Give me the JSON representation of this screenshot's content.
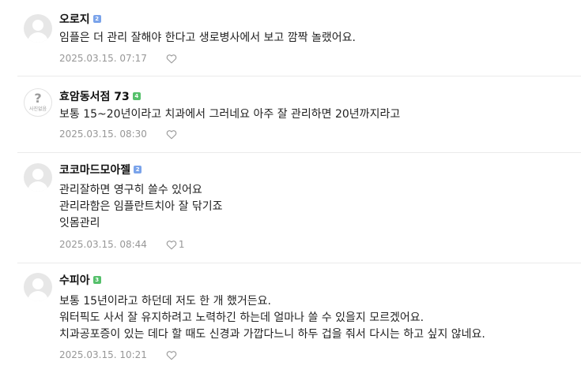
{
  "comments": [
    {
      "nickname": "오로지",
      "level": "2",
      "lines": [
        "임플은 더 관리 잘해야 한다고 생로병사에서 보고 깜짝 놀랬어요."
      ],
      "date": "2025.03.15. 07:17",
      "likes": ""
    },
    {
      "nickname": "효암동서점 73",
      "level": "4",
      "avatar_text": "사진없음",
      "lines": [
        "보통 15~20년이라고 치과에서 그러네요 아주 잘 관리하면 20년까지라고"
      ],
      "date": "2025.03.15. 08:30",
      "likes": ""
    },
    {
      "nickname": "코코마드모아젤",
      "level": "2",
      "lines": [
        "관리잘하면 영구히 쓸수 있어요",
        "관리라함은 임플란트치아 잘 닦기죠",
        "잇몸관리"
      ],
      "date": "2025.03.15. 08:44",
      "likes": "1"
    },
    {
      "nickname": "수피아",
      "level": "3",
      "lines": [
        "보통 15년이라고 하던데 저도 한 개 했거든요.",
        "워터픽도 사서 잘 유지하려고 노력하긴 하는데 얼마나 쓸 수 있을지 모르겠어요.",
        "치과공포증이 있는 데다 할 때도 신경과 가깝다느니 하두 겁을 줘서 다시는 하고 싶지 않네요."
      ],
      "date": "2025.03.15. 10:21",
      "likes": ""
    }
  ],
  "colors": {
    "level_blue": "#7aa3ea",
    "level_green": "#55c06b",
    "meta_gray": "#979797",
    "divider": "#ebebeb"
  },
  "icons": {
    "avatar_default": "person-silhouette-icon",
    "like": "heart-outline-icon"
  }
}
